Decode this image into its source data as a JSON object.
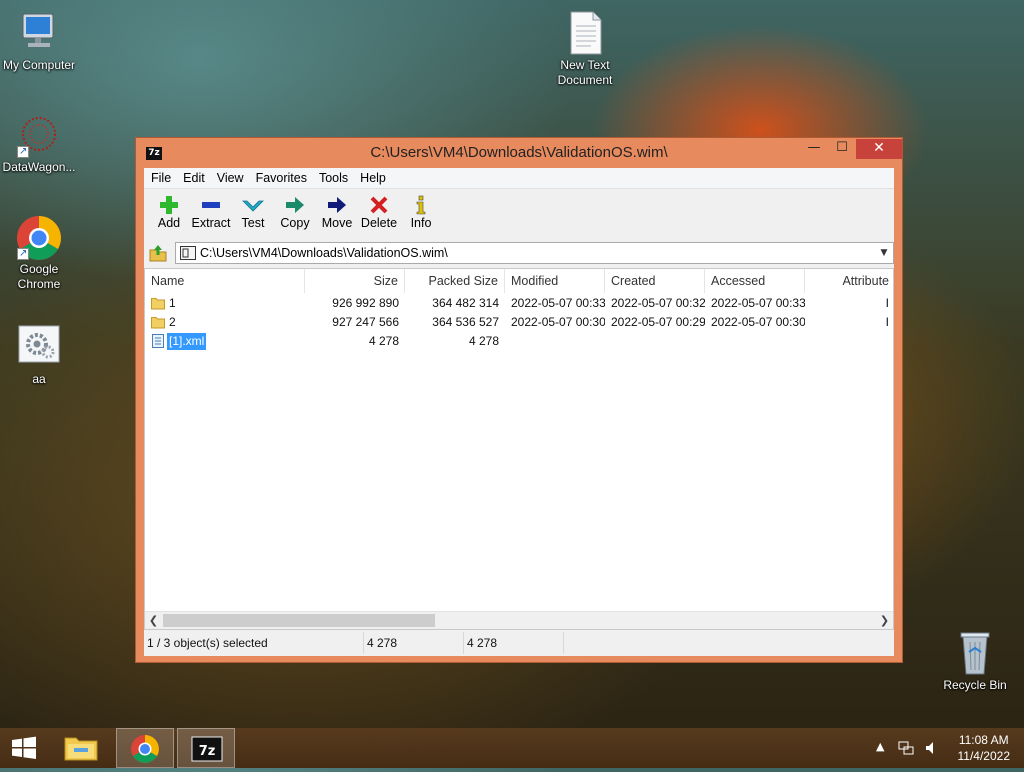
{
  "desktop": {
    "icons": [
      {
        "label": "My Computer"
      },
      {
        "label": "DataWagon..."
      },
      {
        "label": "Google Chrome"
      },
      {
        "label": "aa"
      },
      {
        "label": "New Text Document"
      },
      {
        "label": "Recycle Bin"
      }
    ]
  },
  "window": {
    "app_icon_text": "7z",
    "title": "C:\\Users\\VM4\\Downloads\\ValidationOS.wim\\",
    "minimize": "—",
    "maximize": "☐",
    "close": "✕",
    "menu": [
      "File",
      "Edit",
      "View",
      "Favorites",
      "Tools",
      "Help"
    ],
    "toolbar": [
      {
        "label": "Add",
        "icon": "plus-icon",
        "color": "#2eb82e"
      },
      {
        "label": "Extract",
        "icon": "minus-icon",
        "color": "#1f3fbf"
      },
      {
        "label": "Test",
        "icon": "checkmark-icon",
        "color": "#22a7c4"
      },
      {
        "label": "Copy",
        "icon": "copy-arrow-icon",
        "color": "#1b8a6b"
      },
      {
        "label": "Move",
        "icon": "move-arrow-icon",
        "color": "#101a7a"
      },
      {
        "label": "Delete",
        "icon": "delete-x-icon",
        "color": "#d42020"
      },
      {
        "label": "Info",
        "icon": "info-icon",
        "color": "#e0c200"
      }
    ],
    "address": "C:\\Users\\VM4\\Downloads\\ValidationOS.wim\\",
    "columns": [
      "Name",
      "Size",
      "Packed Size",
      "Modified",
      "Created",
      "Accessed",
      "Attribute"
    ],
    "rows": [
      {
        "name": "1",
        "type": "folder",
        "size": "926 992 890",
        "packed": "364 482 314",
        "modified": "2022-05-07 00:33",
        "created": "2022-05-07 00:32",
        "accessed": "2022-05-07 00:33",
        "attr": "I"
      },
      {
        "name": "2",
        "type": "folder",
        "size": "927 247 566",
        "packed": "364 536 527",
        "modified": "2022-05-07 00:30",
        "created": "2022-05-07 00:29",
        "accessed": "2022-05-07 00:30",
        "attr": "I"
      },
      {
        "name": "[1].xml",
        "type": "file",
        "size": "4 278",
        "packed": "4 278",
        "modified": "",
        "created": "",
        "accessed": "",
        "attr": "",
        "selected": true
      }
    ],
    "status": {
      "selection": "1 / 3 object(s) selected",
      "size": "4 278",
      "packed": "4 278"
    }
  },
  "taskbar": {
    "clock_time": "11:08 AM",
    "clock_date": "11/4/2022"
  },
  "colors": {
    "window_frame": "#e78a5e",
    "close_button": "#c7423b",
    "selection": "#3399ff"
  }
}
